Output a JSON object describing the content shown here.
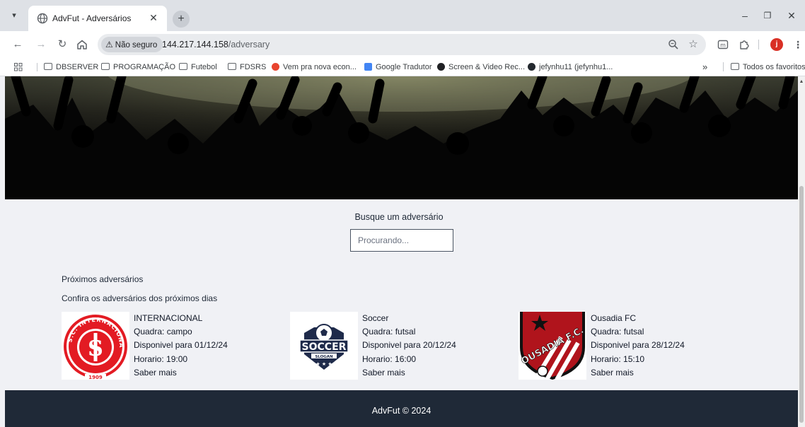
{
  "tab": {
    "title": "AdvFut - Adversários"
  },
  "window": {
    "minimize": "–",
    "restore": "❐",
    "close": "✕"
  },
  "toolbar": {
    "security_label": "Não seguro",
    "url_host": "144.217.144.158",
    "url_path": "/adversary"
  },
  "bookmarks": [
    {
      "label": "DBSERVER"
    },
    {
      "label": "PROGRAMAÇÃO"
    },
    {
      "label": "Futebol"
    },
    {
      "label": "FDSRS"
    },
    {
      "label": "Vem pra nova econ..."
    },
    {
      "label": "Google Tradutor"
    },
    {
      "label": "Screen & Video Rec..."
    },
    {
      "label": "jefynhu11 (jefynhu1..."
    }
  ],
  "bookmarks_overflow": "»",
  "bookmarks_all": "Todos os favoritos",
  "avatar_letter": "j",
  "search": {
    "label": "Busque um adversário",
    "placeholder": "Procurando..."
  },
  "section": {
    "title": "Próximos adversários",
    "subtitle": "Confira os adversários dos próximos dias"
  },
  "adversaries": [
    {
      "name": "INTERNACIONAL",
      "quadra": "Quadra: campo",
      "disponivel": "Disponivel para 01/12/24",
      "horario": "Horario: 19:00",
      "link": "Saber mais",
      "logo_text_ring": "S.C. INTERNACIONAL",
      "logo_year": "1909",
      "logo_monogram": "SCI"
    },
    {
      "name": "Soccer",
      "quadra": "Quadra: futsal",
      "disponivel": "Disponivel para 20/12/24",
      "horario": "Horario: 16:00",
      "link": "Saber mais",
      "logo_word": "SOCCER",
      "logo_slogan": "SLOGAN"
    },
    {
      "name": "Ousadia FC",
      "quadra": "Quadra: futsal",
      "disponivel": "Disponivel para 28/12/24",
      "horario": "Horario: 15:10",
      "link": "Saber mais",
      "logo_word": "OUSADIA F.C."
    }
  ],
  "footer": {
    "text": "AdvFut © 2024"
  },
  "colors": {
    "footer_bg": "#1f2937",
    "page_bg": "#f0f1f5",
    "inter_red": "#e31b23",
    "soccer_navy": "#1e2a4a",
    "ousadia_red": "#b0141c"
  }
}
